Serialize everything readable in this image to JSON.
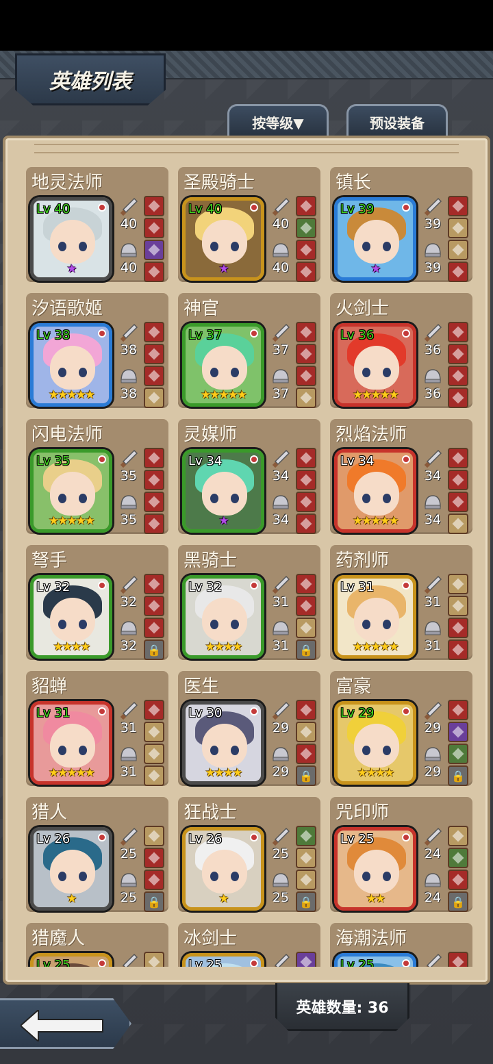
{
  "screen": {
    "title": "英雄列表",
    "sort_tab_label": "按等级▼",
    "preset_tab_label": "预设装备",
    "hero_count_label": "英雄数量: 36"
  },
  "colors": {
    "panel": "#d8c6a7",
    "card": "#a48c6e",
    "frame_gray": "#4b4b4b",
    "frame_gold": "#c8931c",
    "frame_blue": "#2a7bd6",
    "frame_green": "#3a9a2a",
    "frame_red": "#c7332b"
  },
  "heroes": [
    {
      "name": "地灵法师",
      "level": "Lv 40",
      "attack": "40",
      "defense": "40",
      "frame": "#4b4b4b",
      "bg": "#d9e3e6",
      "hair": "#c8d3d6",
      "stars": "★",
      "star_type": "purple",
      "lv_green": true,
      "slots": [
        "red",
        "red",
        "purple",
        "red"
      ]
    },
    {
      "name": "圣殿骑士",
      "level": "Lv 40",
      "attack": "40",
      "defense": "40",
      "frame": "#c8931c",
      "bg": "#8a6a3a",
      "hair": "#f2d37a",
      "stars": "★",
      "star_type": "purple",
      "lv_green": true,
      "slots": [
        "red",
        "green",
        "red",
        "red"
      ]
    },
    {
      "name": "镇长",
      "level": "Lv 39",
      "attack": "39",
      "defense": "39",
      "frame": "#2a7bd6",
      "bg": "#6fb7e8",
      "hair": "#c98a3a",
      "stars": "★",
      "star_type": "purple",
      "lv_green": true,
      "slots": [
        "red",
        "tan",
        "tan",
        "red"
      ]
    },
    {
      "name": "汐语歌姬",
      "level": "Lv 38",
      "attack": "38",
      "defense": "38",
      "frame": "#2a7bd6",
      "bg": "#9fb5e8",
      "hair": "#f2a6d6",
      "stars": "★★★★★",
      "star_type": "gold",
      "lv_green": true,
      "slots": [
        "red",
        "red",
        "red",
        "tan"
      ]
    },
    {
      "name": "神官",
      "level": "Lv 37",
      "attack": "37",
      "defense": "37",
      "frame": "#3a9a2a",
      "bg": "#7fc26a",
      "hair": "#5ad19a",
      "stars": "★★★★★",
      "star_type": "gold",
      "lv_green": true,
      "slots": [
        "red",
        "red",
        "red",
        "tan"
      ]
    },
    {
      "name": "火剑士",
      "level": "Lv 36",
      "attack": "36",
      "defense": "36",
      "frame": "#c7332b",
      "bg": "#d86a5a",
      "hair": "#e23a2a",
      "stars": "★★★★★",
      "star_type": "gold",
      "lv_green": true,
      "slots": [
        "red",
        "red",
        "red",
        "red"
      ]
    },
    {
      "name": "闪电法师",
      "level": "Lv 35",
      "attack": "35",
      "defense": "35",
      "frame": "#3a9a2a",
      "bg": "#88c06a",
      "hair": "#e9cf8a",
      "stars": "★★★★★",
      "star_type": "gold",
      "lv_green": true,
      "slots": [
        "red",
        "red",
        "red",
        "red"
      ]
    },
    {
      "name": "灵媒师",
      "level": "Lv 34",
      "attack": "34",
      "defense": "34",
      "frame": "#3a9a2a",
      "bg": "#4d7a4a",
      "hair": "#5fd6b0",
      "stars": "★",
      "star_type": "purple",
      "lv_green": false,
      "slots": [
        "red",
        "red",
        "red",
        "red"
      ]
    },
    {
      "name": "烈焰法师",
      "level": "Lv 34",
      "attack": "34",
      "defense": "34",
      "frame": "#c7332b",
      "bg": "#e09a6a",
      "hair": "#f07a2a",
      "stars": "★★★★★",
      "star_type": "gold",
      "lv_green": false,
      "slots": [
        "red",
        "red",
        "red",
        "tan"
      ]
    },
    {
      "name": "弩手",
      "level": "Lv 32",
      "attack": "32",
      "defense": "32",
      "frame": "#3a9a2a",
      "bg": "#e8e8e0",
      "hair": "#2a3a4a",
      "stars": "★★★★",
      "star_type": "gold",
      "lv_green": false,
      "slots": [
        "red",
        "red",
        "red",
        "locked"
      ]
    },
    {
      "name": "黑骑士",
      "level": "Lv 32",
      "attack": "31",
      "defense": "31",
      "frame": "#3a9a2a",
      "bg": "#d8d8d0",
      "hair": "#e8e8e8",
      "stars": "★★★★",
      "star_type": "gold",
      "lv_green": false,
      "slots": [
        "red",
        "red",
        "tan",
        "locked"
      ]
    },
    {
      "name": "药剂师",
      "level": "Lv 31",
      "attack": "31",
      "defense": "31",
      "frame": "#c8931c",
      "bg": "#f2e6c8",
      "hair": "#e9b56a",
      "stars": "★★★★★",
      "star_type": "gold",
      "lv_green": false,
      "slots": [
        "tan",
        "tan",
        "red",
        "red"
      ]
    },
    {
      "name": "貂蝉",
      "level": "Lv 31",
      "attack": "31",
      "defense": "31",
      "frame": "#c7332b",
      "bg": "#e89a9a",
      "hair": "#f08aa0",
      "stars": "★★★★★",
      "star_type": "gold",
      "lv_green": true,
      "slots": [
        "red",
        "tan",
        "tan",
        "tan"
      ]
    },
    {
      "name": "医生",
      "level": "Lv 30",
      "attack": "29",
      "defense": "29",
      "frame": "#4b4b4b",
      "bg": "#d6d6e0",
      "hair": "#5a5a7a",
      "stars": "★★★★",
      "star_type": "gold",
      "lv_green": false,
      "slots": [
        "red",
        "tan",
        "red",
        "locked"
      ]
    },
    {
      "name": "富豪",
      "level": "Lv 29",
      "attack": "29",
      "defense": "29",
      "frame": "#c8931c",
      "bg": "#e6c86a",
      "hair": "#f0d03a",
      "stars": "★★★★",
      "star_type": "gold",
      "lv_green": true,
      "slots": [
        "red",
        "purple",
        "green",
        "locked"
      ]
    },
    {
      "name": "猎人",
      "level": "Lv 26",
      "attack": "25",
      "defense": "25",
      "frame": "#4b4b4b",
      "bg": "#b8c0c8",
      "hair": "#2a6a8a",
      "stars": "★",
      "star_type": "gold",
      "lv_green": false,
      "slots": [
        "tan",
        "red",
        "red",
        "locked"
      ]
    },
    {
      "name": "狂战士",
      "level": "Lv 26",
      "attack": "25",
      "defense": "25",
      "frame": "#c8931c",
      "bg": "#d8d0c0",
      "hair": "#f0f0f0",
      "stars": "★",
      "star_type": "gold",
      "lv_green": false,
      "slots": [
        "green",
        "tan",
        "tan",
        "locked"
      ]
    },
    {
      "name": "咒印师",
      "level": "Lv 25",
      "attack": "24",
      "defense": "24",
      "frame": "#c7332b",
      "bg": "#e6b88a",
      "hair": "#e08a3a",
      "stars": "★★",
      "star_type": "gold",
      "lv_green": false,
      "slots": [
        "tan",
        "green",
        "red",
        "locked"
      ]
    },
    {
      "name": "猎魔人",
      "level": "Lv 25",
      "attack": "",
      "defense": "",
      "frame": "#c8931c",
      "bg": "#c8a070",
      "hair": "#6a4a3a",
      "stars": "",
      "star_type": "gold",
      "lv_green": true,
      "slots": [
        "tan",
        "",
        "",
        ""
      ]
    },
    {
      "name": "冰剑士",
      "level": "Lv 25",
      "attack": "",
      "defense": "",
      "frame": "#c8931c",
      "bg": "#a0c0e0",
      "hair": "#c0e0f0",
      "stars": "",
      "star_type": "gold",
      "lv_green": false,
      "slots": [
        "purple",
        "",
        "",
        ""
      ]
    },
    {
      "name": "海潮法师",
      "level": "Lv 25",
      "attack": "",
      "defense": "",
      "frame": "#2a7bd6",
      "bg": "#8ac0e8",
      "hair": "#3a8ac0",
      "stars": "",
      "star_type": "gold",
      "lv_green": true,
      "slots": [
        "red",
        "",
        "",
        ""
      ]
    }
  ]
}
